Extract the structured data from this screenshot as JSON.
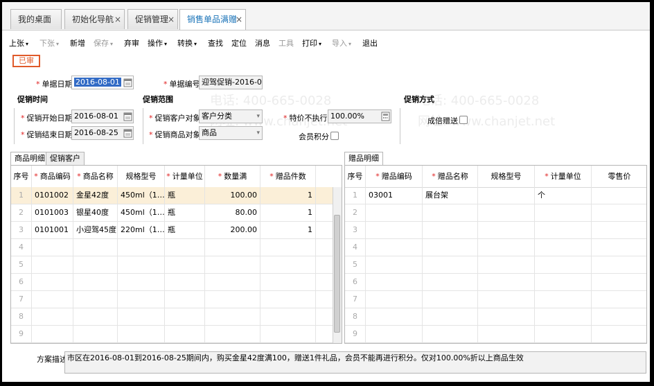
{
  "tabs": [
    {
      "label": "我的桌面"
    },
    {
      "label": "初始化导航",
      "close": "×"
    },
    {
      "label": "促销管理",
      "close": "×"
    },
    {
      "label": "销售单品满赠",
      "close": "×"
    }
  ],
  "toolbar": {
    "prev": "上张",
    "next": "下张",
    "new": "新增",
    "save": "保存",
    "discard": "弃审",
    "ops": "操作",
    "convert": "转换",
    "find": "查找",
    "locate": "定位",
    "msg": "消息",
    "tools": "工具",
    "print": "打印",
    "import": "导入",
    "exit": "退出",
    "caret": "▾"
  },
  "status_badge": "已审",
  "form": {
    "doc_date_label": "单据日期",
    "doc_date": "2016-08-01",
    "doc_no_label": "单据编号",
    "doc_no": "迎驾促销-2016-0…",
    "period_title": "促销时间",
    "start_label": "促销开始日期",
    "start": "2016-08-01",
    "end_label": "促销结束日期",
    "end": "2016-08-25",
    "scope_title": "促销范围",
    "cust_obj_label": "促销客户对象",
    "cust_obj": "客户分类",
    "goods_obj_label": "促销商品对象",
    "goods_obj": "商品",
    "special_label": "特价不执行",
    "special": "100.00%",
    "member_label": "会员积分",
    "mode_title": "促销方式",
    "multi_label": "成倍赠送",
    "req": "*"
  },
  "left_tabs": [
    "商品明细",
    "促销客户"
  ],
  "left_grid": {
    "headers": [
      "序号",
      "商品编码",
      "商品名称",
      "规格型号",
      "计量单位",
      "数量满",
      "赠品件数"
    ],
    "required": [
      false,
      true,
      true,
      false,
      true,
      true,
      true
    ],
    "rows": [
      [
        "1",
        "0101002",
        "金星42度",
        "450ml（1…",
        "瓶",
        "100.00",
        "1"
      ],
      [
        "2",
        "0101003",
        "银星40度",
        "450ml（1…",
        "瓶",
        "80.00",
        "1"
      ],
      [
        "3",
        "0101001",
        "小迎驾45度",
        "220ml（1…",
        "瓶",
        "200.00",
        "1"
      ]
    ],
    "empty_nums": [
      "4",
      "5",
      "6",
      "7",
      "8",
      "9"
    ]
  },
  "right_tabs": [
    "赠品明细"
  ],
  "right_grid": {
    "headers": [
      "序号",
      "赠品编码",
      "赠品名称",
      "规格型号",
      "计量单位",
      "零售价"
    ],
    "required": [
      false,
      true,
      true,
      false,
      true,
      false
    ],
    "rows": [
      [
        "1",
        "03001",
        "展台架",
        "",
        "个",
        ""
      ]
    ],
    "empty_nums": [
      "2",
      "3",
      "4",
      "5",
      "6",
      "7",
      "8",
      "9"
    ]
  },
  "desc_label": "方案描述",
  "desc_text": "市区在2016-08-01到2016-08-25期间内，购买金星42度满100，赠送1件礼品，会员不能再进行积分。仅对100.00%折以上商品生效",
  "watermark": {
    "phone": "电话: 400-665-0028",
    "site": "网址: www.chanjet.net"
  },
  "colors": {
    "accent": "#1a73b8",
    "badge": "#e05a2a",
    "required": "#e02020",
    "selected_row": "#fbefd8"
  }
}
